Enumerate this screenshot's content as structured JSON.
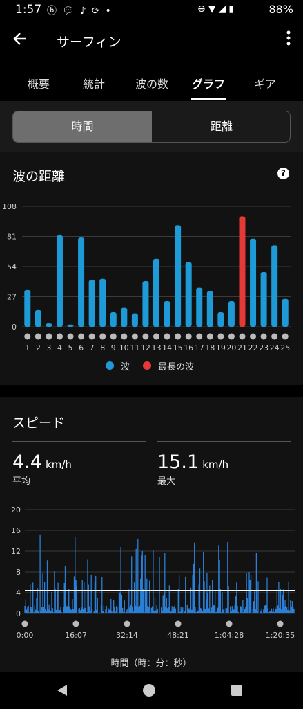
{
  "status_bar": {
    "time": "1:57",
    "battery": "88%",
    "left_icons": [
      "notification-badge-icon",
      "chat-icon",
      "music-note-icon",
      "sync-icon",
      "dot-icon"
    ],
    "right_icons": [
      "do-not-disturb-icon",
      "wifi-icon",
      "signal-icon",
      "battery-icon"
    ]
  },
  "app_bar": {
    "title": "サーフィン"
  },
  "tabs": [
    {
      "label": "概要"
    },
    {
      "label": "統計"
    },
    {
      "label": "波の数"
    },
    {
      "label": "グラフ"
    },
    {
      "label": "ギア"
    }
  ],
  "active_tab": "グラフ",
  "segment": {
    "option_a": "時間",
    "option_b": "距離",
    "selected": "時間"
  },
  "wave_chart": {
    "title": "波の距離",
    "legend": {
      "wave": "波",
      "longest": "最長の波"
    },
    "colors": {
      "wave": "#1e9ad6",
      "longest": "#e53935"
    }
  },
  "speed_section": {
    "title": "スピード",
    "avg_value": "4.4",
    "avg_unit": "km/h",
    "avg_label": "平均",
    "max_value": "15.1",
    "max_unit": "km/h",
    "max_label": "最大",
    "xlabel": "時間（時：分：秒）"
  },
  "chart_data": [
    {
      "type": "bar",
      "title": "波の距離",
      "categories": [
        "1",
        "2",
        "3",
        "4",
        "5",
        "6",
        "7",
        "8",
        "9",
        "10",
        "11",
        "12",
        "13",
        "14",
        "15",
        "16",
        "17",
        "18",
        "19",
        "20",
        "21",
        "22",
        "23",
        "24",
        "25"
      ],
      "series": [
        {
          "name": "波",
          "values": [
            33,
            15,
            3,
            82,
            2,
            80,
            42,
            43,
            13,
            17,
            12,
            41,
            61,
            23,
            91,
            58,
            35,
            32,
            13,
            23,
            99,
            79,
            49,
            73,
            25
          ]
        }
      ],
      "highlight_index": 20,
      "highlight_label": "最長の波",
      "yticks": [
        0,
        27,
        54,
        81,
        108
      ],
      "ylim": [
        0,
        108
      ]
    },
    {
      "type": "area",
      "title": "スピード",
      "xticks": [
        "0:00",
        "16:07",
        "32:14",
        "48:21",
        "1:04:28",
        "1:20:35"
      ],
      "yticks": [
        0,
        4,
        8,
        12,
        16,
        20
      ],
      "ylim": [
        0,
        20
      ],
      "average_line": 4.4,
      "xlabel": "時間（時：分：秒）"
    }
  ]
}
